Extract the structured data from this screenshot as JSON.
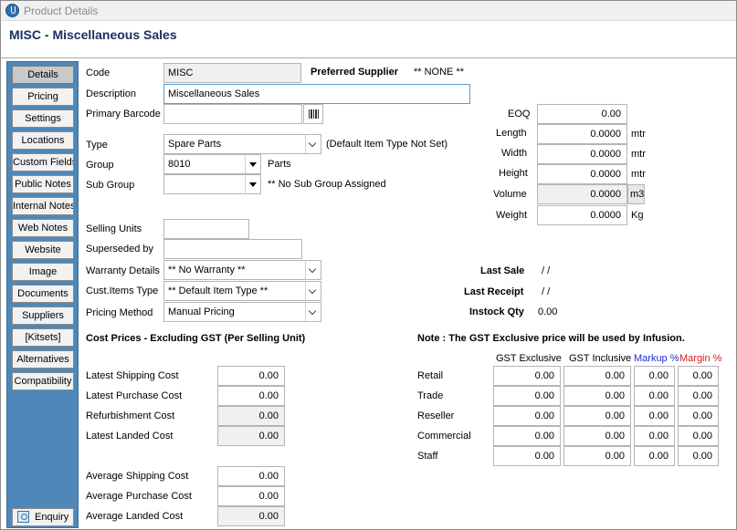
{
  "window": {
    "title": "Product Details"
  },
  "header": {
    "title": "MISC - Miscellaneous Sales"
  },
  "sidebar": {
    "items": [
      "Details",
      "Pricing",
      "Settings",
      "Locations",
      "Custom Fields",
      "Public Notes",
      "Internal Notes",
      "Web Notes",
      "Website",
      "Image",
      "Documents",
      "Suppliers",
      "[Kitsets]",
      "Alternatives",
      "Compatibility"
    ],
    "active": "Details",
    "enquiry_label": "Enquiry"
  },
  "details": {
    "code_label": "Code",
    "code_value": "MISC",
    "preferred_supplier_label": "Preferred Supplier",
    "preferred_supplier_value": "** NONE **",
    "description_label": "Description",
    "description_value": "Miscellaneous Sales",
    "barcode_label": "Primary Barcode",
    "barcode_value": "",
    "type_label": "Type",
    "type_value": "Spare Parts",
    "type_note": "(Default Item Type Not Set)",
    "group_label": "Group",
    "group_value": "8010",
    "group_note": "Parts",
    "subgroup_label": "Sub Group",
    "subgroup_value": "",
    "subgroup_note": "** No Sub Group Assigned",
    "selling_units_label": "Selling Units",
    "selling_units_value": "",
    "superseded_label": "Superseded by",
    "superseded_value": "",
    "warranty_label": "Warranty Details",
    "warranty_value": "** No Warranty **",
    "custitems_label": "Cust.Items Type",
    "custitems_value": "** Default Item Type **",
    "pricing_method_label": "Pricing Method",
    "pricing_method_value": "Manual Pricing"
  },
  "dimensions": {
    "eoq_label": "EOQ",
    "eoq_value": "0.00",
    "length_label": "Length",
    "length_value": "0.0000",
    "length_unit": "mtr",
    "width_label": "Width",
    "width_value": "0.0000",
    "width_unit": "mtr",
    "height_label": "Height",
    "height_value": "0.0000",
    "height_unit": "mtr",
    "volume_label": "Volume",
    "volume_value": "0.0000",
    "volume_unit": "m3",
    "weight_label": "Weight",
    "weight_value": "0.0000",
    "weight_unit": "Kg"
  },
  "stats": {
    "last_sale_label": "Last Sale",
    "last_sale_value": "/ /",
    "last_receipt_label": "Last Receipt",
    "last_receipt_value": "/ /",
    "instock_label": "Instock Qty",
    "instock_value": "0.00"
  },
  "costs": {
    "heading": "Cost Prices - Excluding GST (Per Selling Unit)",
    "latest_shipping_label": "Latest Shipping Cost",
    "latest_shipping_value": "0.00",
    "latest_purchase_label": "Latest Purchase Cost",
    "latest_purchase_value": "0.00",
    "refurb_label": "Refurbishment Cost",
    "refurb_value": "0.00",
    "latest_landed_label": "Latest Landed Cost",
    "latest_landed_value": "0.00",
    "avg_shipping_label": "Average Shipping Cost",
    "avg_shipping_value": "0.00",
    "avg_purchase_label": "Average Purchase Cost",
    "avg_purchase_value": "0.00",
    "avg_landed_label": "Average Landed Cost",
    "avg_landed_value": "0.00"
  },
  "prices": {
    "note": "Note : The GST Exclusive price will be used by Infusion.",
    "col_excl": "GST Exclusive",
    "col_incl": "GST Inclusive",
    "col_markup": "Markup %",
    "col_margin": "Margin %",
    "colors": {
      "markup": "#1f2fd0",
      "margin": "#d21f1f"
    },
    "rows": [
      {
        "label": "Retail",
        "excl": "0.00",
        "incl": "0.00",
        "markup": "0.00",
        "margin": "0.00"
      },
      {
        "label": "Trade",
        "excl": "0.00",
        "incl": "0.00",
        "markup": "0.00",
        "margin": "0.00"
      },
      {
        "label": "Reseller",
        "excl": "0.00",
        "incl": "0.00",
        "markup": "0.00",
        "margin": "0.00"
      },
      {
        "label": "Commercial",
        "excl": "0.00",
        "incl": "0.00",
        "markup": "0.00",
        "margin": "0.00"
      },
      {
        "label": "Staff",
        "excl": "0.00",
        "incl": "0.00",
        "markup": "0.00",
        "margin": "0.00"
      }
    ]
  }
}
